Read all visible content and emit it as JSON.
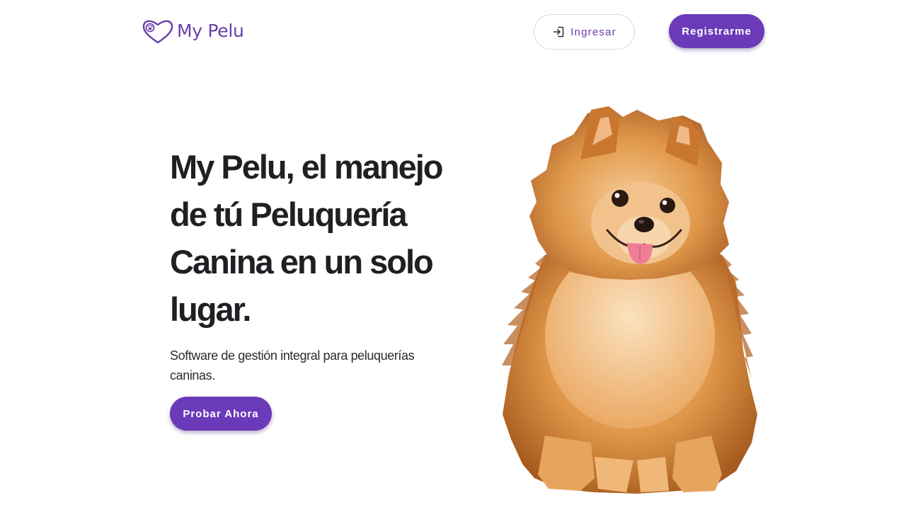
{
  "header": {
    "logo_text": "My Pelu",
    "logo_icon": "heart-paw-icon",
    "login_label": "Ingresar",
    "login_icon": "login-arrow-icon",
    "register_label": "Registrarme"
  },
  "hero": {
    "title": "My Pelu, el manejo de tú Peluquería Canina en un solo lugar.",
    "subtitle": "Software de gestión integral para peluquerías caninas.",
    "cta_label": "Probar Ahora",
    "image": "pomeranian-dog-illustration"
  },
  "colors": {
    "brand": "#6a3ab8",
    "brand_text": "#6a3ea8",
    "heading": "#1f2023",
    "button_text": "#ffffff",
    "dog_fur": "#d98a3a"
  }
}
